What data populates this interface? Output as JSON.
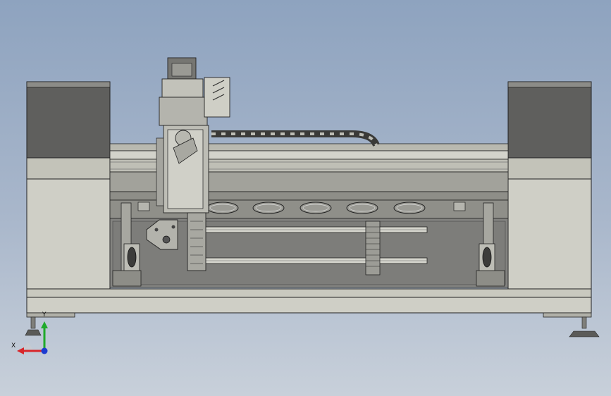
{
  "axes": {
    "y_label": "Y",
    "x_label": "X"
  },
  "colors": {
    "frame_fill": "#c9c9bf",
    "frame_dark": "#6a6a66",
    "tower_dark": "#5e5e5c",
    "line": "#2a2a2a",
    "rail_light": "#d5d5cd",
    "axis_y": "#1faa2a",
    "axis_x": "#d8262a",
    "axis_z": "#1d3bd0"
  }
}
